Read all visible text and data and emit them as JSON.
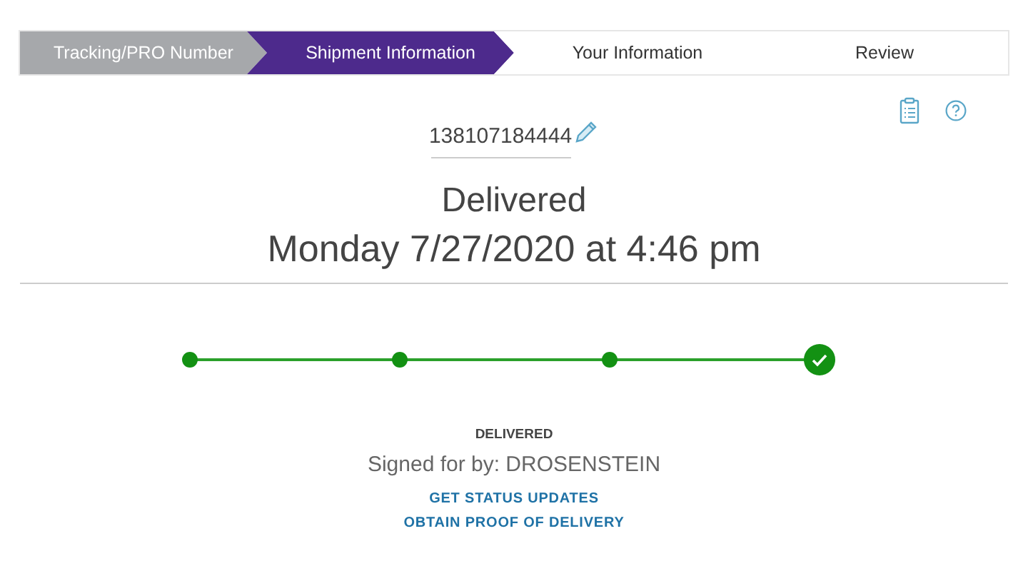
{
  "steps": [
    {
      "label": "Tracking/PRO Number",
      "kind": "done"
    },
    {
      "label": "Shipment Information",
      "kind": "current"
    },
    {
      "label": "Your Information",
      "kind": "upcoming"
    },
    {
      "label": "Review",
      "kind": "upcoming"
    }
  ],
  "tracking_number": "138107184444",
  "status": "Delivered",
  "delivered_at": "Monday 7/27/2020 at 4:46 pm",
  "progress": [
    {
      "kind": "dot"
    },
    {
      "kind": "dot"
    },
    {
      "kind": "dot"
    },
    {
      "kind": "check"
    }
  ],
  "status_label": "DELIVERED",
  "signed_for": "Signed for by: DROSENSTEIN",
  "links": [
    "GET STATUS UPDATES",
    "OBTAIN PROOF OF DELIVERY"
  ]
}
